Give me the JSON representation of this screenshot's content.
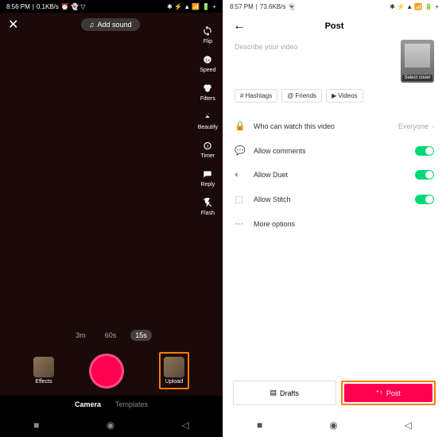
{
  "left": {
    "statusbar": {
      "time": "8:56 PM",
      "speed": "0.1KB/s",
      "icons": "⏰ 👻 ▽",
      "battery": "🔋"
    },
    "addSound": "Add sound",
    "tools": [
      {
        "icon": "flip",
        "label": "Flip"
      },
      {
        "icon": "speed",
        "label": "Speed"
      },
      {
        "icon": "filters",
        "label": "Filters"
      },
      {
        "icon": "beautify",
        "label": "Beautify"
      },
      {
        "icon": "timer",
        "label": "Timer"
      },
      {
        "icon": "reply",
        "label": "Reply"
      },
      {
        "icon": "flash",
        "label": "Flash"
      }
    ],
    "durations": [
      "3m",
      "60s",
      "15s"
    ],
    "activeDuration": "15s",
    "effects": "Effects",
    "upload": "Upload",
    "modes": [
      "Camera",
      "Templates"
    ],
    "activeMode": "Camera"
  },
  "right": {
    "statusbar": {
      "time": "8:57 PM",
      "speed": "73.6KB/s",
      "icons": "👻",
      "battery": "🔋"
    },
    "title": "Post",
    "describePlaceholder": "Describe your video",
    "coverLabel": "Select cover",
    "tags": [
      {
        "icon": "#",
        "label": "Hashtags"
      },
      {
        "icon": "@",
        "label": "Friends"
      },
      {
        "icon": "▶",
        "label": "Videos"
      }
    ],
    "settings": [
      {
        "icon": "lock",
        "label": "Who can watch this video",
        "value": "Everyone",
        "type": "link"
      },
      {
        "icon": "comment",
        "label": "Allow comments",
        "type": "toggle"
      },
      {
        "icon": "duet",
        "label": "Allow Duet",
        "type": "toggle"
      },
      {
        "icon": "stitch",
        "label": "Allow Stitch",
        "type": "toggle"
      },
      {
        "icon": "more",
        "label": "More options",
        "type": "link"
      }
    ],
    "drafts": "Drafts",
    "post": "Post"
  }
}
